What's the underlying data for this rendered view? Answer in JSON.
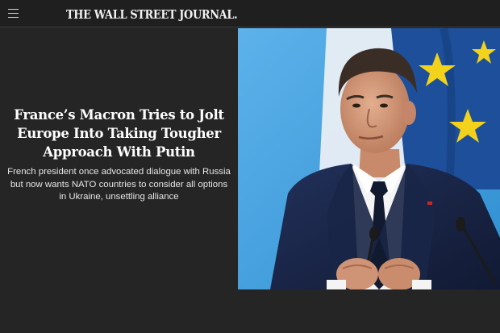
{
  "header": {
    "menu_icon": "hamburger-menu-icon",
    "masthead": "THE WALL STREET JOURNAL."
  },
  "article": {
    "headline": "France’s Macron Tries to Jolt Europe Into Taking Tougher Approach With Putin",
    "dek": "French president once advocated dialogue with Russia but now wants NATO countries to consider all options in Ukraine, unsettling alliance",
    "image": {
      "subject": "photo-emmanuel-macron-at-podium",
      "colors": {
        "sky": "#4aa6e2",
        "flag_blue": "#1d4f9a",
        "flag_white": "#e9eef4",
        "star_yellow": "#f3d21b",
        "suit": "#17223d",
        "shirt": "#f4f4f4",
        "tie": "#121a30",
        "skin": "#d59a7a",
        "hair": "#3a2d25"
      }
    }
  },
  "theme": {
    "page_background": "#252525",
    "topbar_background": "#1f1f1f",
    "headline_color": "#ffffff",
    "dek_color": "#e6e6e6"
  }
}
